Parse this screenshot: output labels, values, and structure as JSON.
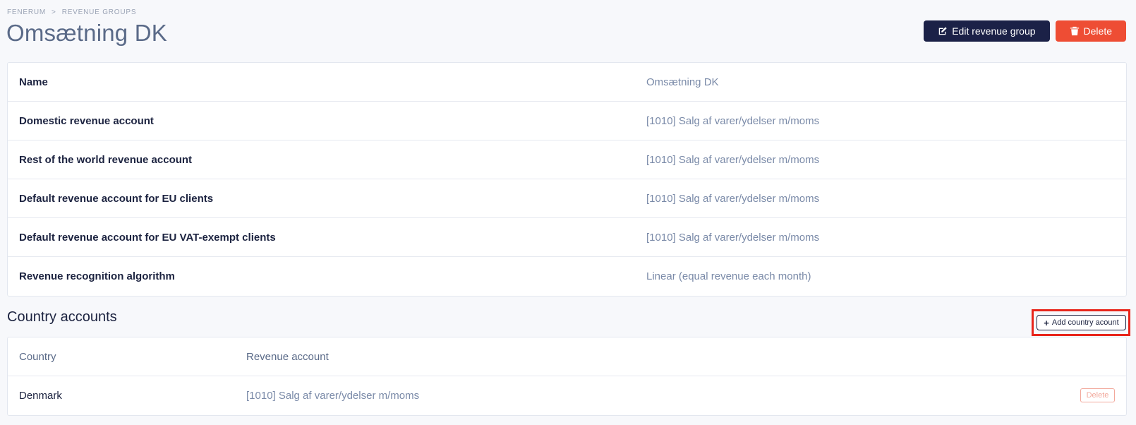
{
  "breadcrumb": {
    "root": "FENERUM",
    "separator": ">",
    "current": "REVENUE GROUPS"
  },
  "page_title": "Omsætning DK",
  "actions": {
    "edit_label": "Edit revenue group",
    "edit_icon": "edit-icon",
    "delete_label": "Delete",
    "delete_icon": "trash-icon"
  },
  "details": [
    {
      "label": "Name",
      "value": "Omsætning DK"
    },
    {
      "label": "Domestic revenue account",
      "value": "[1010] Salg af varer/ydelser m/moms"
    },
    {
      "label": "Rest of the world revenue account",
      "value": "[1010] Salg af varer/ydelser m/moms"
    },
    {
      "label": "Default revenue account for EU clients",
      "value": "[1010] Salg af varer/ydelser m/moms"
    },
    {
      "label": "Default revenue account for EU VAT-exempt clients",
      "value": "[1010] Salg af varer/ydelser m/moms"
    },
    {
      "label": "Revenue recognition algorithm",
      "value": "Linear (equal revenue each month)"
    }
  ],
  "country_accounts": {
    "title": "Country accounts",
    "add_label": "Add country acount",
    "columns": [
      "Country",
      "Revenue account"
    ],
    "rows": [
      {
        "country": "Denmark",
        "account": "[1010] Salg af varer/ydelser m/moms",
        "delete_label": "Delete"
      }
    ]
  },
  "colors": {
    "primary": "#1b2147",
    "danger": "#ee4d34",
    "highlight": "#e8251b"
  }
}
